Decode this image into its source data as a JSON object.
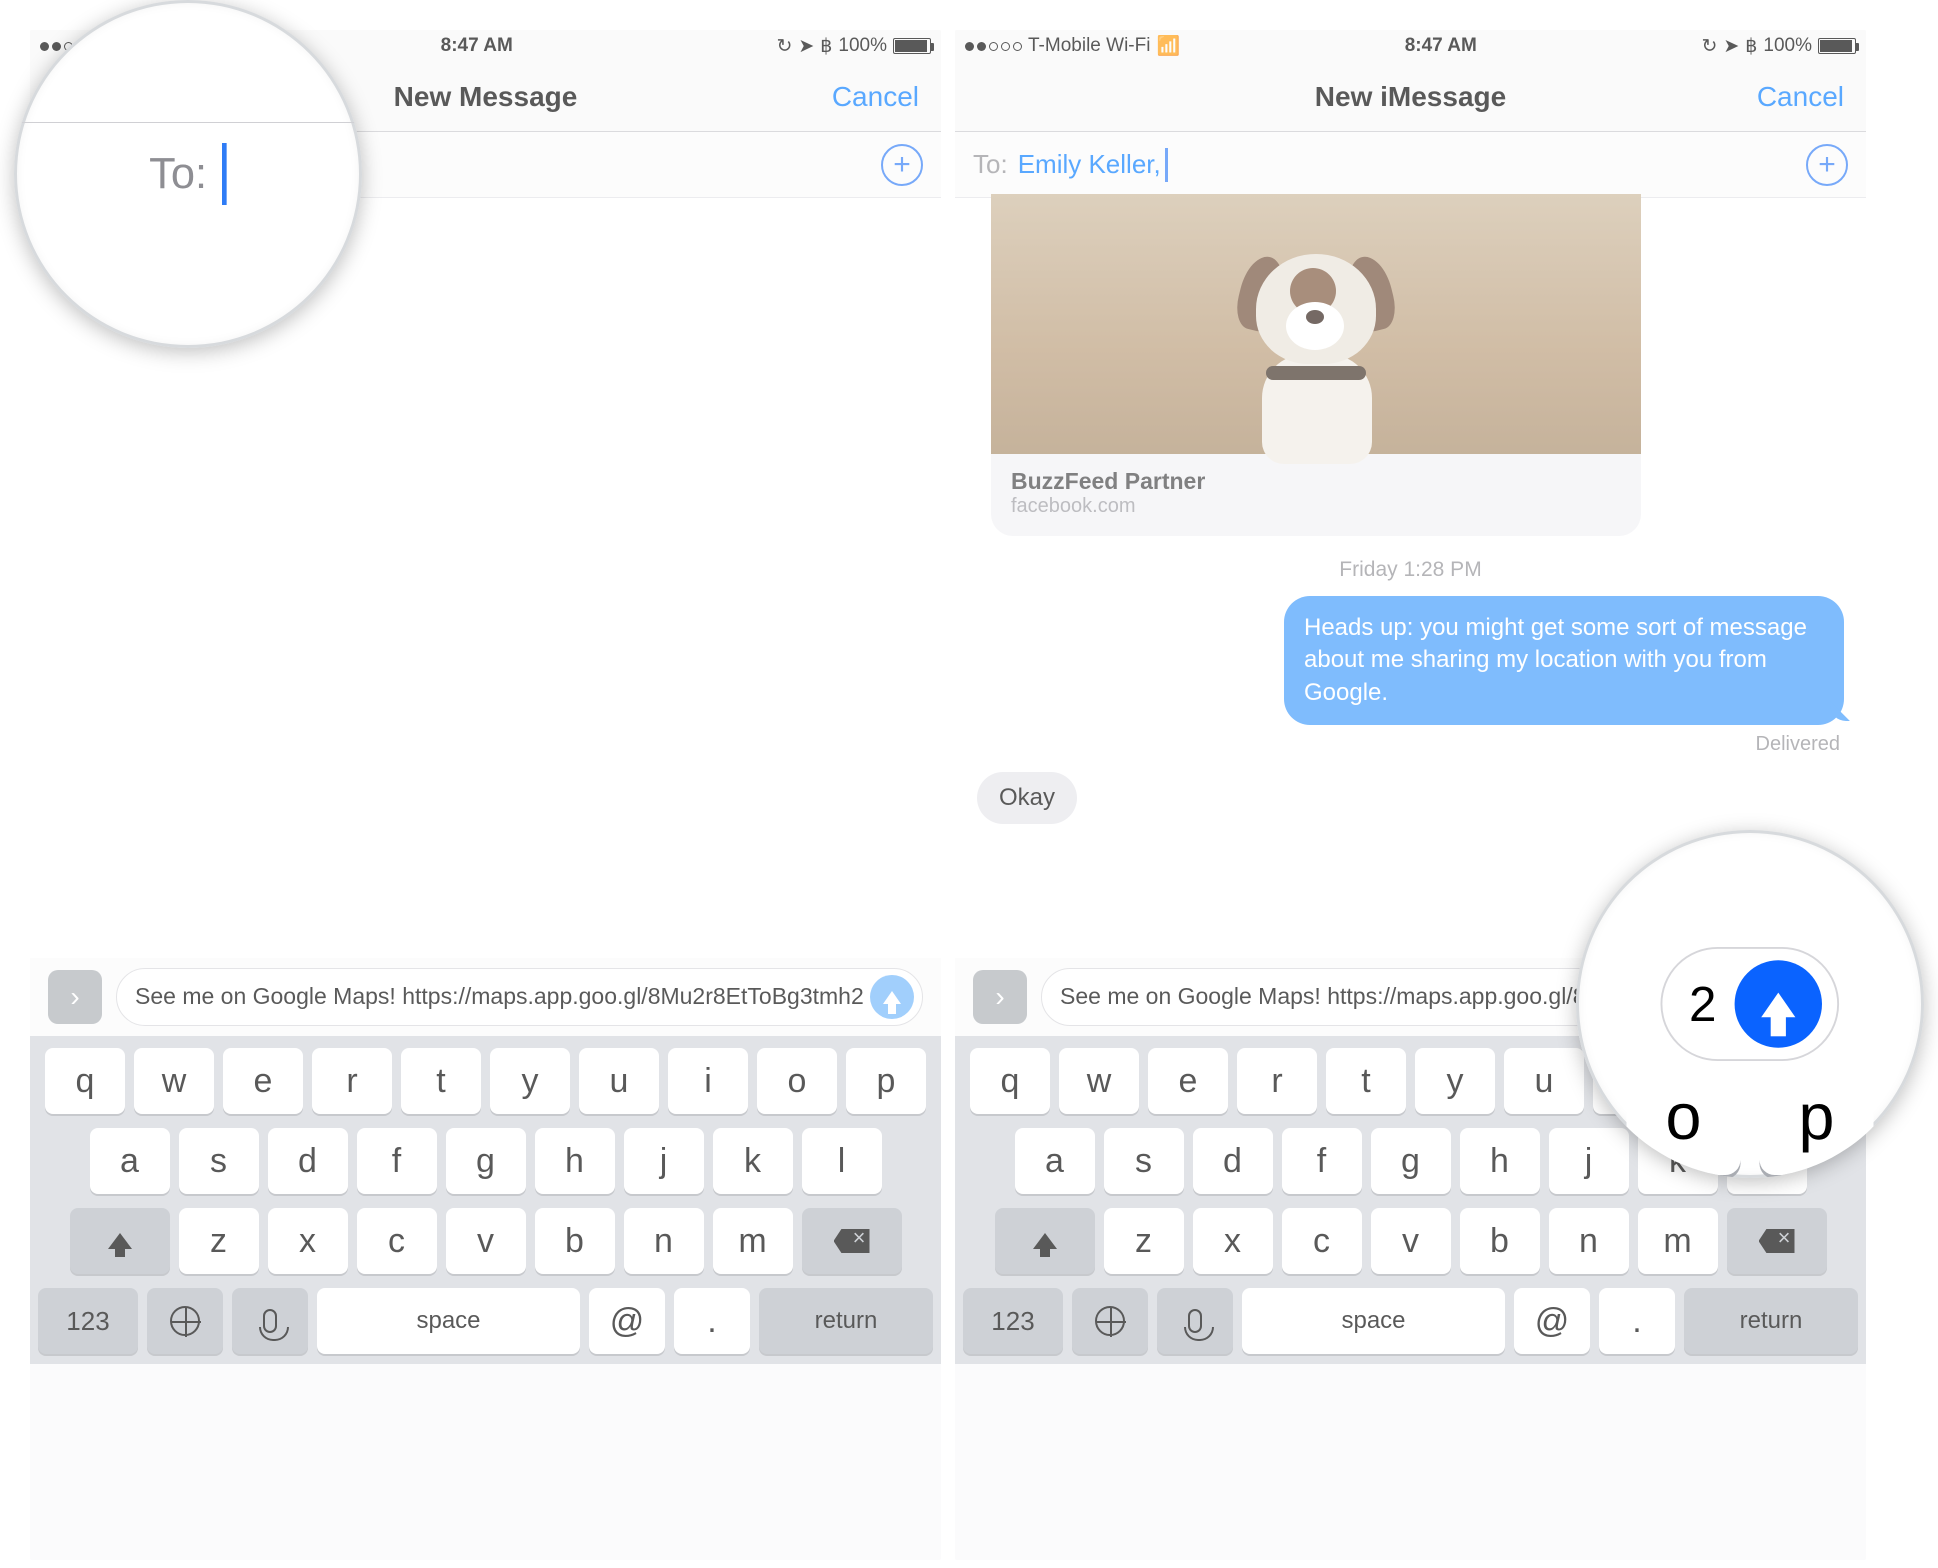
{
  "status": {
    "carrier_left": "T-Mobile Wi-Fi",
    "short_wifi": "Wi-Fi",
    "time": "8:47 AM",
    "battery_pct": "100%"
  },
  "left": {
    "nav_title": "New Message",
    "cancel": "Cancel",
    "to_label": "To:",
    "compose_text": "See me on Google Maps! https://maps.app.goo.gl/8Mu2r8EtToBg3tmh2"
  },
  "right": {
    "nav_title": "New iMessage",
    "cancel": "Cancel",
    "to_label": "To:",
    "recipient": "Emily Keller,",
    "card_title": "BuzzFeed Partner",
    "card_sub": "facebook.com",
    "timestamp": "Friday 1:28 PM",
    "out_msg": "Heads up: you might get some sort of message about me sharing my location with you from Google.",
    "delivered": "Delivered",
    "in_msg": "Okay",
    "compose_text": "See me on Google Maps! https://maps.app.goo.gl/8Mu2r8EtToBg3tmh2"
  },
  "mag2_digit": "2",
  "keyboard": {
    "row1": [
      "q",
      "w",
      "e",
      "r",
      "t",
      "y",
      "u",
      "i",
      "o",
      "p"
    ],
    "row2": [
      "a",
      "s",
      "d",
      "f",
      "g",
      "h",
      "j",
      "k",
      "l"
    ],
    "row3": [
      "z",
      "x",
      "c",
      "v",
      "b",
      "n",
      "m"
    ],
    "num": "123",
    "space": "space",
    "at": "@",
    "dot": ".",
    "ret": "return"
  }
}
